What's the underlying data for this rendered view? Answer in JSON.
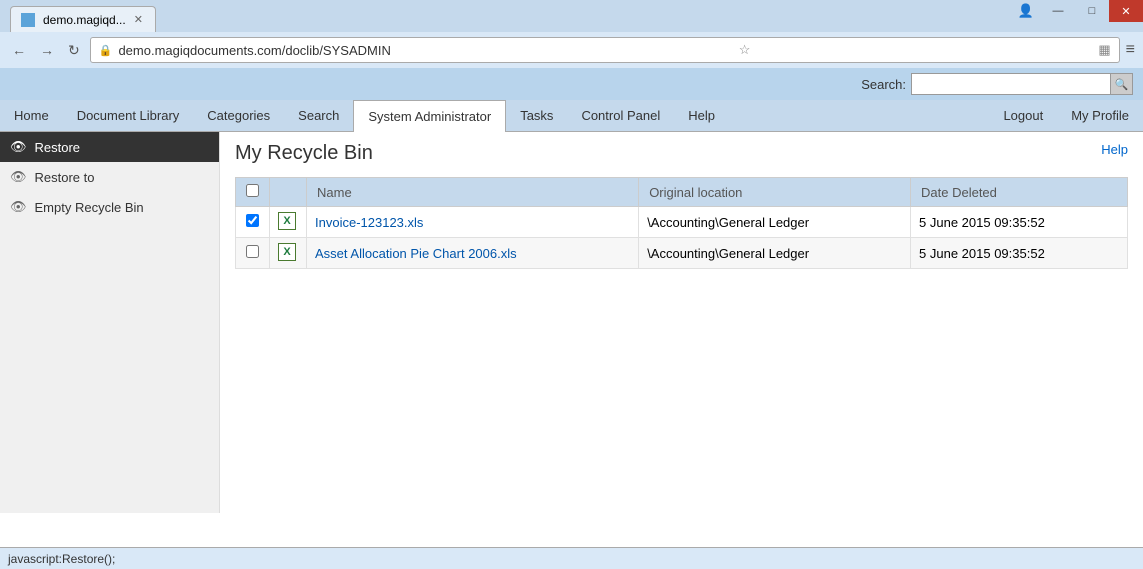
{
  "browser": {
    "tab_label": "demo.magiqd...",
    "tab_favicon": "📄",
    "url": "demo.magiqdocuments.com/doclib/SYSADMIN",
    "window_controls": {
      "minimize": "—",
      "maximize": "□",
      "close": "✕"
    }
  },
  "app_search": {
    "label": "Search:",
    "placeholder": "",
    "button_icon": "🔍"
  },
  "nav": {
    "items": [
      {
        "label": "Home",
        "active": false
      },
      {
        "label": "Document Library",
        "active": false
      },
      {
        "label": "Categories",
        "active": false
      },
      {
        "label": "Search",
        "active": false
      },
      {
        "label": "System Administrator",
        "active": true
      },
      {
        "label": "Tasks",
        "active": false
      },
      {
        "label": "Control Panel",
        "active": false
      },
      {
        "label": "Help",
        "active": false
      }
    ],
    "right_items": [
      {
        "label": "Logout"
      },
      {
        "label": "My Profile"
      }
    ]
  },
  "sidebar": {
    "items": [
      {
        "label": "Restore",
        "active": true
      },
      {
        "label": "Restore to",
        "active": false
      },
      {
        "label": "Empty Recycle Bin",
        "active": false
      }
    ]
  },
  "content": {
    "title": "My Recycle Bin",
    "help_label": "Help",
    "table": {
      "columns": [
        {
          "label": "",
          "key": "checkbox"
        },
        {
          "label": "",
          "key": "icon"
        },
        {
          "label": "Name",
          "key": "name"
        },
        {
          "label": "Original location",
          "key": "location"
        },
        {
          "label": "Date Deleted",
          "key": "date"
        }
      ],
      "rows": [
        {
          "checked": true,
          "name": "Invoice-123123.xls",
          "location": "\\Accounting\\General Ledger",
          "date": "5 June 2015 09:35:52"
        },
        {
          "checked": false,
          "name": "Asset Allocation Pie Chart 2006.xls",
          "location": "\\Accounting\\General Ledger",
          "date": "5 June 2015 09:35:52"
        }
      ]
    }
  },
  "status_bar": {
    "text": "javascript:Restore();"
  }
}
